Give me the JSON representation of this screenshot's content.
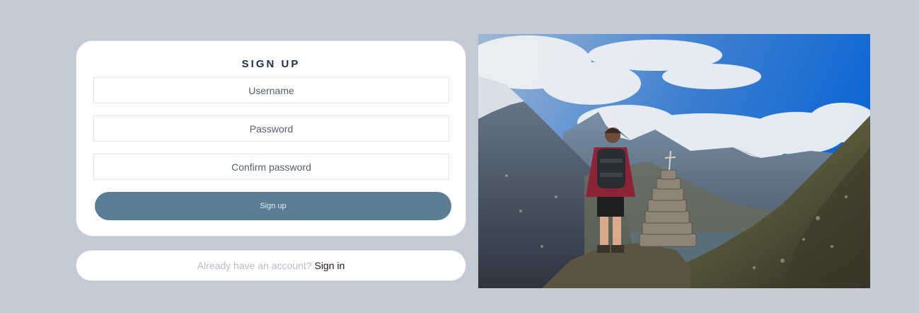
{
  "signup_form": {
    "title": "SIGN UP",
    "username_placeholder": "Username",
    "password_placeholder": "Password",
    "confirm_placeholder": "Confirm password",
    "submit_label": "Sign up"
  },
  "signin": {
    "prompt": "Already have an account?",
    "link_label": "Sign in"
  },
  "photo": {
    "icon": "mountain-hiker-photo"
  },
  "colors": {
    "background": "#c4c9d6",
    "button": "#5a7d95",
    "title": "#1f2f45"
  }
}
